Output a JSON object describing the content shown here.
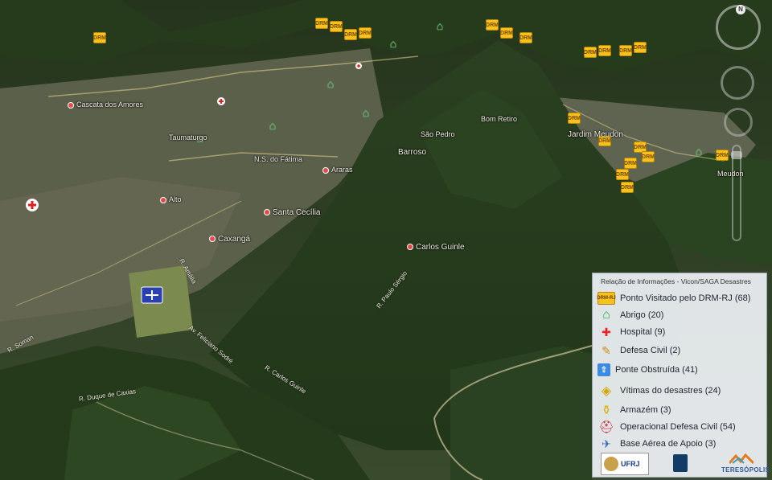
{
  "map": {
    "places": [
      {
        "label": "Cascata dos Amores"
      },
      {
        "label": "Taumaturgo"
      },
      {
        "label": "N.S. do Fátima"
      },
      {
        "label": "Araras"
      },
      {
        "label": "Alto"
      },
      {
        "label": "Santa Cecília"
      },
      {
        "label": "Caxangá"
      },
      {
        "label": "São Pedro"
      },
      {
        "label": "Bom Retiro"
      },
      {
        "label": "Barroso"
      },
      {
        "label": "Carlos Guinle"
      },
      {
        "label": "Jardim Meudon"
      },
      {
        "label": "Meudon"
      }
    ],
    "roads": [
      {
        "label": "R. Paulo Sérgio"
      },
      {
        "label": "R. Carlos Guinle"
      },
      {
        "label": "Av. Feliciano Sodré"
      },
      {
        "label": "R. Duque de Caxias"
      },
      {
        "label": "R. Amália"
      },
      {
        "label": "R. Soman"
      }
    ],
    "marker_label": "DRM"
  },
  "nav": {
    "north": "N"
  },
  "legend": {
    "title": "Relação de Informações - Vicon/SAGA Desastres",
    "items": [
      {
        "icon": "drm-icon",
        "label": "Ponto Visitado pelo DRM-RJ (68)",
        "badge": "DRM-RJ"
      },
      {
        "icon": "abrigo-icon",
        "label": "Abrigo (20)"
      },
      {
        "icon": "hospital-icon",
        "label": "Hospital (9)"
      },
      {
        "icon": "defesa-civil-icon",
        "label": "Defesa Civil (2)"
      },
      {
        "icon": "ponte-obstruida-icon",
        "label": "Ponte Obstruída (41)"
      },
      {
        "icon": "vitimas-icon",
        "label": "Vítimas do desastres (24)"
      },
      {
        "icon": "armazem-icon",
        "label": "Armazém (3)"
      },
      {
        "icon": "operacional-icon",
        "label": "Operacional Defesa Civil (54)"
      },
      {
        "icon": "base-aerea-icon",
        "label": "Base Aérea de Apoio (3)"
      }
    ],
    "logos": {
      "ufrj": "UFRJ",
      "teresopolis": "TERESÓPOLIS"
    }
  },
  "colors": {
    "drm": "#f7c21e",
    "abrigo": "#23b33a",
    "hospital": "#e02020",
    "forest": "#2f4a25"
  }
}
